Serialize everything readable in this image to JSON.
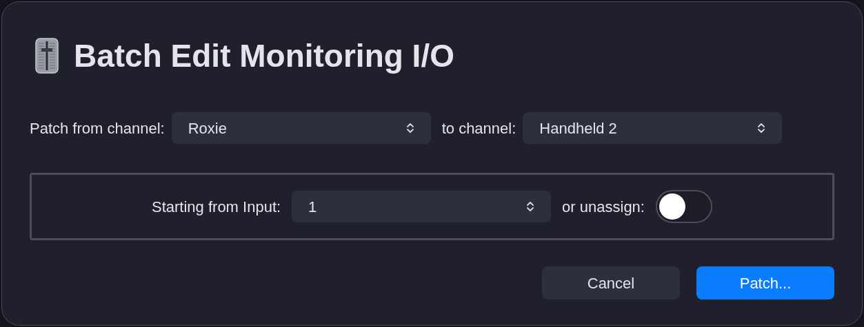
{
  "dialog": {
    "title": "Batch Edit Monitoring I/O"
  },
  "patch_row": {
    "from_label": "Patch from channel:",
    "from_value": "Roxie",
    "to_label": "to channel:",
    "to_value": "Handheld 2"
  },
  "input_group": {
    "label": "Starting from Input:",
    "value": "1",
    "unassign_label": "or unassign:",
    "unassign_on": false
  },
  "buttons": [
    {
      "label": "Cancel",
      "kind": "secondary"
    },
    {
      "label": "Patch...",
      "kind": "primary"
    }
  ]
}
